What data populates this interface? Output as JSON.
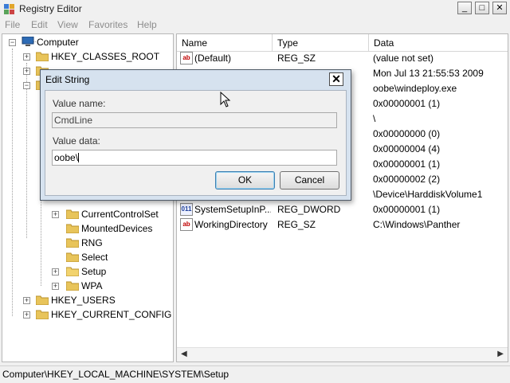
{
  "window": {
    "title": "Registry Editor",
    "controls": {
      "minimize": "_",
      "maximize": "□",
      "close": "✕"
    }
  },
  "menu": [
    "File",
    "Edit",
    "View",
    "Favorites",
    "Help"
  ],
  "tree": {
    "root": "Computer",
    "hkcr": "HKEY_CLASSES_ROOT",
    "system_children": [
      "CurrentControlSet",
      "MountedDevices",
      "RNG",
      "Select",
      "Setup",
      "WPA"
    ],
    "hku": "HKEY_USERS",
    "hkcc": "HKEY_CURRENT_CONFIG"
  },
  "list": {
    "columns": [
      "Name",
      "Type",
      "Data"
    ],
    "rows": [
      {
        "name": "(Default)",
        "type": "REG_SZ",
        "data": "(value not set)",
        "icon": "ab"
      },
      {
        "name": "",
        "type": "",
        "data": "Mon Jul 13 21:55:53 2009",
        "icon": ""
      },
      {
        "name": "",
        "type": "",
        "data": "oobe\\windeploy.exe",
        "icon": ""
      },
      {
        "name": "",
        "type": "",
        "data": "0x00000001 (1)",
        "icon": ""
      },
      {
        "name": "",
        "type": "",
        "data": "\\",
        "icon": ""
      },
      {
        "name": "",
        "type": "",
        "data": "0x00000000 (0)",
        "icon": ""
      },
      {
        "name": "",
        "type": "",
        "data": "0x00000004 (4)",
        "icon": ""
      },
      {
        "name": "",
        "type": "",
        "data": "0x00000001 (1)",
        "icon": ""
      },
      {
        "name": "",
        "type": "",
        "data": "0x00000002 (2)",
        "icon": ""
      },
      {
        "name": "",
        "type": "",
        "data": "\\Device\\HarddiskVolume1",
        "icon": ""
      },
      {
        "name": "SystemSetupInP...",
        "type": "REG_DWORD",
        "data": "0x00000001 (1)",
        "icon": "011"
      },
      {
        "name": "WorkingDirectory",
        "type": "REG_SZ",
        "data": "C:\\Windows\\Panther",
        "icon": "ab"
      }
    ]
  },
  "status": "Computer\\HKEY_LOCAL_MACHINE\\SYSTEM\\Setup",
  "dialog": {
    "title": "Edit String",
    "value_name_label": "Value name:",
    "value_name": "CmdLine",
    "value_data_label": "Value data:",
    "value_data": "oobe\\",
    "ok": "OK",
    "cancel": "Cancel",
    "close": "✕"
  },
  "colors": {
    "dialog_frame": "#d6e2ef",
    "window_bg": "#f0f0f0",
    "reg_sz_icon": "#c00000",
    "reg_dword_icon": "#1c3d9a"
  }
}
